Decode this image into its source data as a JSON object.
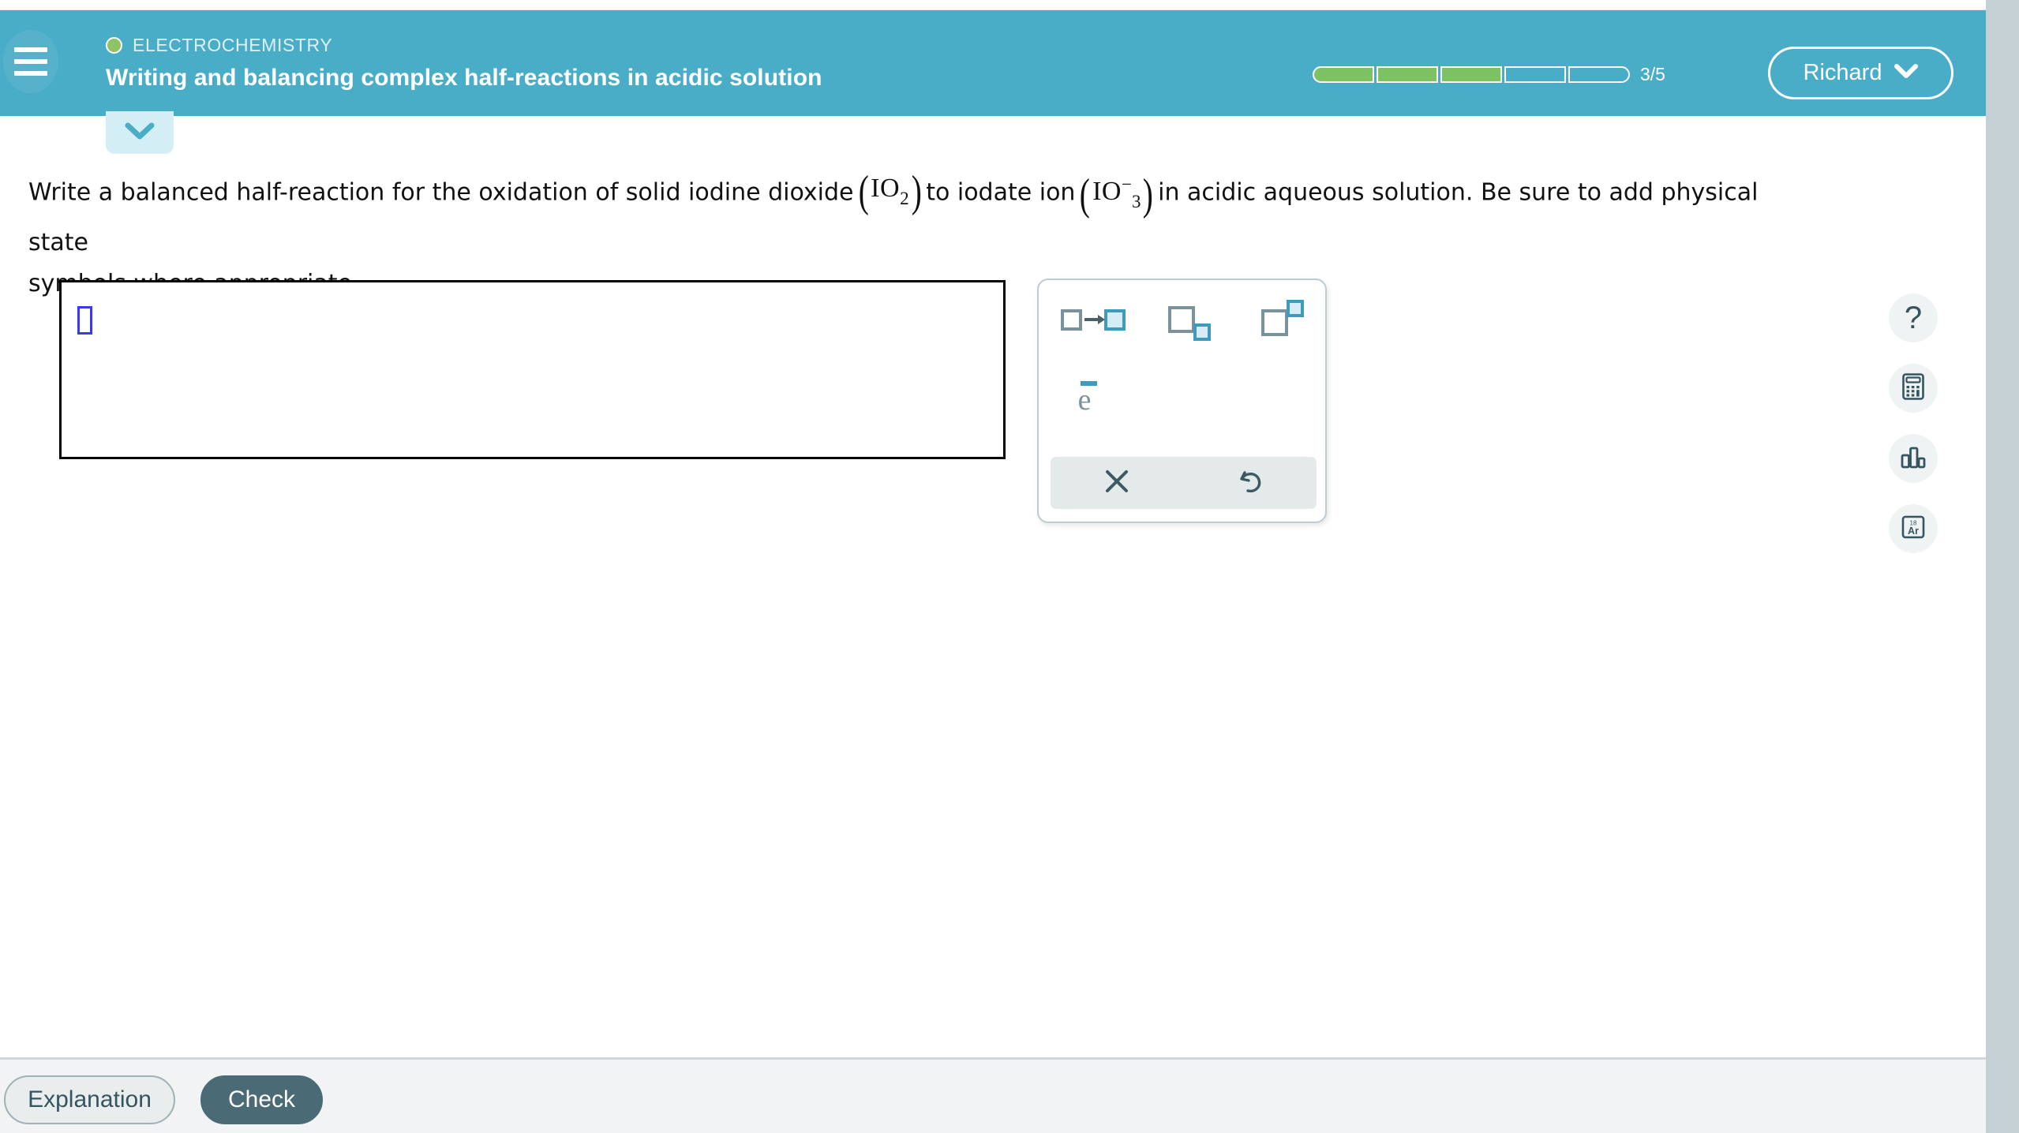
{
  "header": {
    "menu_icon": "hamburger-menu-icon",
    "topic_dot": "status-dot-green",
    "topic_label": "ELECTROCHEMISTRY",
    "lesson_title": "Writing and balancing complex half-reactions in acidic solution",
    "progress": {
      "text": "3/5",
      "total": 5,
      "completed": 3,
      "filled_color": "#7cc162",
      "empty_color": "transparent"
    },
    "user": {
      "name": "Richard",
      "caret_icon": "chevron-down-icon"
    },
    "bg_color": "#4aadc8"
  },
  "collapse_tab": {
    "icon": "chevron-down-icon",
    "bg_color": "#d4eef5"
  },
  "question": {
    "part1": "Write a balanced half-reaction for the oxidation of solid iodine dioxide",
    "formula1": {
      "symbol": "IO",
      "sub": "2",
      "sup": ""
    },
    "part2": "to iodate ion",
    "formula2": {
      "symbol": "IO",
      "sub": "3",
      "sup": "−"
    },
    "part3": "in acidic aqueous solution. Be sure to add physical state",
    "part4": "symbols where appropriate."
  },
  "answer": {
    "value": "",
    "placeholder": "",
    "cursor_color": "#3a3ae8"
  },
  "palette": {
    "tools": [
      {
        "name": "reaction-arrow-tool",
        "label": "□→□"
      },
      {
        "name": "subscript-tool",
        "label": "□₂"
      },
      {
        "name": "superscript-tool",
        "label": "□²"
      },
      {
        "name": "electron-tool",
        "label": "e⁻"
      }
    ],
    "electron_symbol": "e",
    "actions": [
      {
        "name": "clear-button",
        "icon": "close-x-icon"
      },
      {
        "name": "undo-button",
        "icon": "undo-arrow-icon"
      }
    ]
  },
  "rail": [
    {
      "name": "help-button",
      "icon": "question-mark-icon",
      "glyph": "?"
    },
    {
      "name": "calculator-button",
      "icon": "calculator-icon"
    },
    {
      "name": "data-reference-button",
      "icon": "bar-chart-icon"
    },
    {
      "name": "periodic-table-button",
      "icon": "periodic-table-icon",
      "element_number": "18",
      "element_symbol": "Ar"
    }
  ],
  "footer": {
    "explanation_label": "Explanation",
    "check_label": "Check",
    "check_bg": "#4a6b76"
  }
}
